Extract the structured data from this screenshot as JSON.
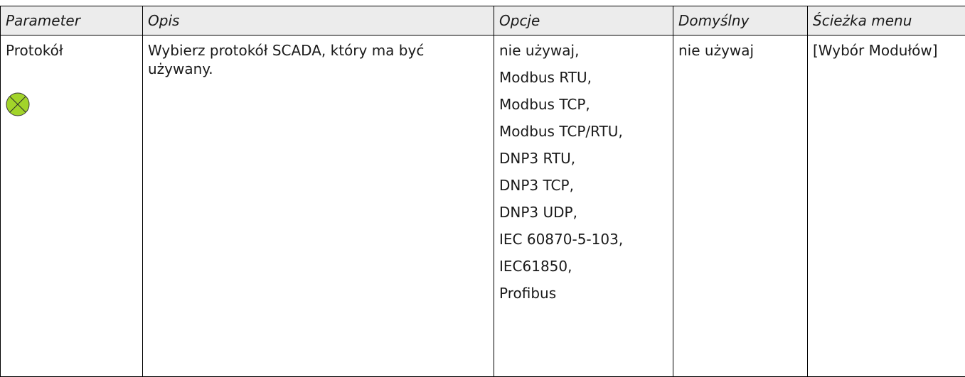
{
  "table": {
    "headers": {
      "parameter": "Parameter",
      "description": "Opis",
      "options": "Opcje",
      "default": "Domyślny",
      "menu_path": "Ścieżka menu"
    },
    "row": {
      "parameter": "Protokół",
      "parameter_icon": "setting-indicator-icon",
      "description": "Wybierz protokół SCADA, który ma być używany.",
      "options": [
        "nie używaj,",
        "Modbus RTU,",
        "Modbus TCP,",
        "Modbus TCP/RTU,",
        "DNP3 RTU,",
        "DNP3 TCP,",
        "DNP3 UDP,",
        "IEC 60870-5-103,",
        "IEC61850,",
        "Profibus"
      ],
      "default": "nie używaj",
      "menu_path": "[Wybór Modułów]"
    }
  },
  "colors": {
    "header_background": "#ececec",
    "icon_fill": "#a2d42a",
    "border": "#000000"
  }
}
